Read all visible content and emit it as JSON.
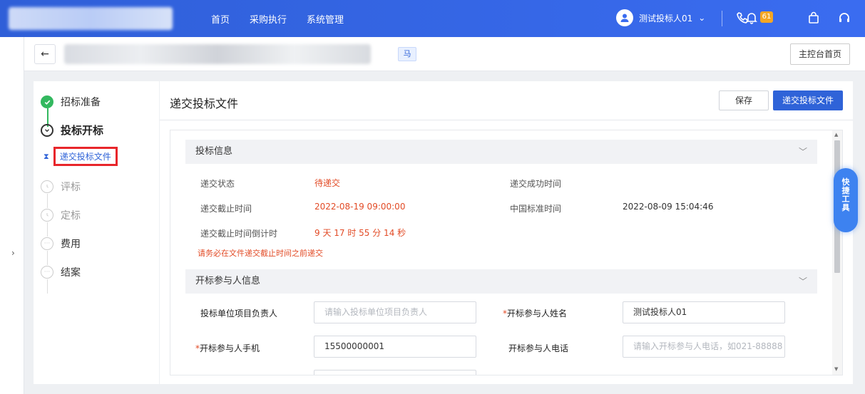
{
  "topbar": {
    "nav": [
      "首页",
      "采购执行",
      "系统管理"
    ],
    "user_name": "测试投标人01",
    "notif_count": "61",
    "colors": {
      "bar": "#3366e6",
      "badge": "#f5a623"
    }
  },
  "header": {
    "back_icon": "arrow-left-icon",
    "tag": "马",
    "home_button": "主控台首页"
  },
  "steps": [
    {
      "label": "招标准备",
      "state": "done"
    },
    {
      "label": "投标开标",
      "state": "current"
    },
    {
      "label": "评标",
      "state": "pending"
    },
    {
      "label": "定标",
      "state": "pending"
    },
    {
      "label": "费用",
      "state": "pending"
    },
    {
      "label": "结案",
      "state": "pending"
    }
  ],
  "substep": {
    "label": "递交投标文件"
  },
  "main": {
    "title": "递交投标文件",
    "save_button": "保存",
    "submit_button": "递交投标文件"
  },
  "bid_info": {
    "title": "投标信息",
    "status_label": "递交状态",
    "status_value": "待递交",
    "success_time_label": "递交成功时间",
    "deadline_label": "递交截止时间",
    "deadline_value": "2022-08-19 09:00:00",
    "cn_time_label": "中国标准时间",
    "cn_time_value": "2022-08-09 15:04:46",
    "countdown_label": "递交截止时间倒计时",
    "countdown_value": "9 天 17 时 55 分 14 秒",
    "warning": "请务必在文件递交截止时间之前递交"
  },
  "participant": {
    "title": "开标参与人信息",
    "leader_label": "投标单位项目负责人",
    "leader_placeholder": "请输入投标单位项目负责人",
    "name_label": "开标参与人姓名",
    "name_value": "测试投标人01",
    "mobile_label": "开标参与人手机",
    "mobile_value": "15500000001",
    "phone_label": "开标参与人电话",
    "phone_placeholder": "请输入开标参与人电话，如021-88888"
  },
  "quick_tools": "快捷工具"
}
